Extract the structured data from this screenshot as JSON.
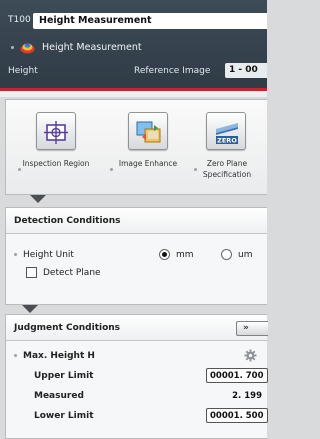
{
  "header": {
    "tool_id": "T100",
    "tool_name": "Height Measurement",
    "sub_label": "Height Measurement",
    "info_left": "Height",
    "info_right": "Reference Image",
    "info_value": "1 - 00"
  },
  "icon_buttons": [
    {
      "label": "Inspection Region",
      "icon": "inspection-region-icon"
    },
    {
      "label": "Image Enhance",
      "icon": "image-enhance-icon"
    },
    {
      "label": "Zero Plane Specification",
      "icon": "zero-plane-icon",
      "badge": "ZERO"
    }
  ],
  "detection": {
    "title": "Detection Conditions",
    "height_unit_label": "Height Unit",
    "unit_options": [
      "mm",
      "um"
    ],
    "selected_unit": "mm",
    "detect_plane_label": "Detect Plane",
    "detect_plane_checked": false
  },
  "judgment": {
    "title": "Judgment Conditions",
    "expand_label": "»",
    "max_height_label": "Max. Height H",
    "upper_limit_label": "Upper Limit",
    "upper_limit_value": "00001. 700",
    "measured_label": "Measured",
    "measured_value": "2. 199",
    "lower_limit_label": "Lower Limit",
    "lower_limit_value": "00001. 500"
  },
  "colors": {
    "header_bg": "#36434e",
    "accent_red": "#c6262b"
  }
}
